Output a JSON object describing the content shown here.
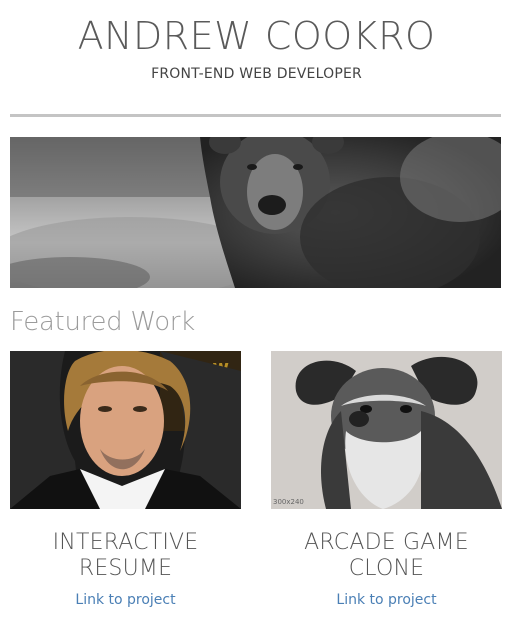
{
  "header": {
    "name": "ANDREW COOKRO",
    "subtitle": "FRONT-END WEB DEVELOPER"
  },
  "hero": {
    "image_name": "bear-photo"
  },
  "featured": {
    "title": "Featured Work",
    "projects": [
      {
        "title_line1": "INTERACTIVE",
        "title_line2": "RESUME",
        "link_label": "Link to project",
        "image_name": "portrait-photo"
      },
      {
        "title_line1": "ARCADE GAME",
        "title_line2": "CLONE",
        "link_label": "Link to project",
        "image_name": "schnauzer-dog-photo",
        "image_caption": "300x240"
      }
    ]
  },
  "colors": {
    "link": "#4a7fb5",
    "divider": "#c4c4c4",
    "section_title": "#9b9b9b"
  }
}
